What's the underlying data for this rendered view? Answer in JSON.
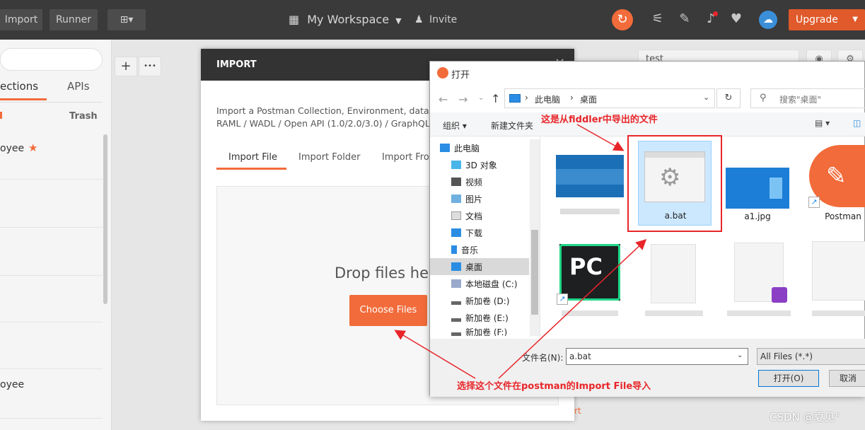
{
  "topbar": {
    "import_label": "Import",
    "runner_label": "Runner",
    "workspace_label": "My Workspace",
    "invite_label": "Invite",
    "upgrade_label": "Upgrade"
  },
  "left": {
    "tab_collections": "ections",
    "tab_apis": "APIs",
    "trash_label": "Trash",
    "item_1": "oyee",
    "item_2": "oyee"
  },
  "tabs_bar": {
    "add": "+",
    "more": "•••"
  },
  "env": {
    "selected": "test"
  },
  "modal": {
    "title": "IMPORT",
    "desc_line1": "Import a Postman Collection, Environment, data d",
    "desc_line2": "RAML / WADL / Open API (1.0/2.0/3.0) / GraphQL",
    "tabs": [
      "Import File",
      "Import Folder",
      "Import Fro"
    ],
    "drop_text": "Drop files her",
    "choose_label": "Choose Files",
    "footer_hint": "rt"
  },
  "dialog": {
    "title": "打开",
    "breadcrumb": [
      "此电脑",
      "桌面"
    ],
    "search_placeholder": "搜索\"桌面\"",
    "organize_label": "组织 ▾",
    "new_folder_label": "新建文件夹",
    "nav_items": [
      "此电脑",
      "3D 对象",
      "视频",
      "图片",
      "文档",
      "下载",
      "音乐",
      "桌面",
      "本地磁盘 (C:)",
      "新加卷 (D:)",
      "新加卷 (E:)",
      "新加卷 (F:)"
    ],
    "files": [
      "a.bat",
      "a1.jpg",
      "Postman"
    ],
    "filename_label": "文件名(N):",
    "filename_value": "a.bat",
    "filetype_value": "All Files (*.*)",
    "open_label": "打开(O)",
    "cancel_label": "取消"
  },
  "annotations": {
    "top_note": "这是从fiddler中导出的文件",
    "bottom_note": "选择这个文件在postman的Import File导入"
  },
  "watermark": "CSDN @夏见°",
  "colors": {
    "accent": "#f26b3a",
    "annotation": "#e8262a",
    "selection": "#cce8ff"
  }
}
